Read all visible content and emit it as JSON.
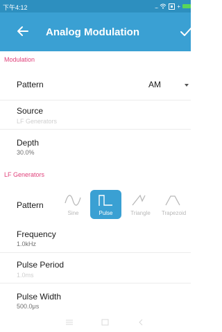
{
  "status": {
    "time": "下午4:12",
    "dots": "..."
  },
  "header": {
    "title": "Analog Modulation"
  },
  "modulation": {
    "section_label": "Modulation",
    "pattern_label": "Pattern",
    "pattern_value": "AM",
    "source_label": "Source",
    "source_value": "LF Generators",
    "depth_label": "Depth",
    "depth_value": "30.0%"
  },
  "lf": {
    "section_label": "LF Generators",
    "pattern_label": "Pattern",
    "waveforms": [
      "Sine",
      "Pulse",
      "Triangle",
      "Trapezoid"
    ],
    "selected": "Pulse",
    "frequency_label": "Frequency",
    "frequency_value": "1.0kHz",
    "pulse_period_label": "Pulse Period",
    "pulse_period_value": "1.0ms",
    "pulse_width_label": "Pulse Width",
    "pulse_width_value": "500.0μs"
  },
  "icons": {
    "back": "arrow-left-icon",
    "confirm": "check-icon",
    "wifi": "wifi-icon",
    "battery": "battery-icon",
    "menu": "menu-icon",
    "home": "home-icon",
    "nav_back": "back-icon"
  },
  "colors": {
    "appbar": "#3aa0d3",
    "statusbar": "#2d8fbf",
    "section": "#e0407a",
    "selected": "#3aa0d3",
    "battery": "#59d659"
  }
}
